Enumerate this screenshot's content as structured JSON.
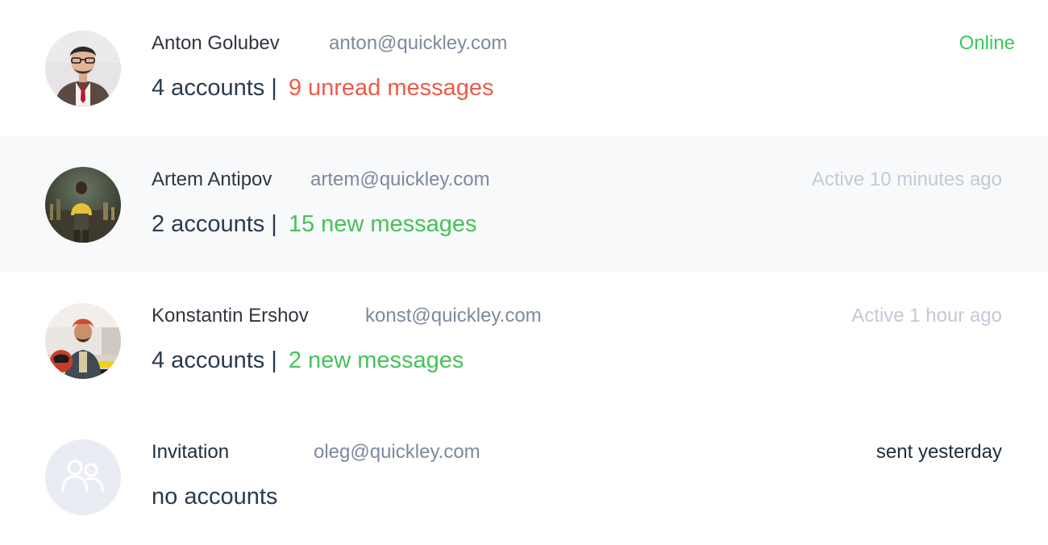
{
  "users": [
    {
      "name": "Anton Golubev",
      "email": "anton@quickley.com",
      "status": "Online",
      "accounts": "4 accounts",
      "separator": "|",
      "messages": "9 unread messages"
    },
    {
      "name": "Artem Antipov",
      "email": "artem@quickley.com",
      "status": "Active 10 minutes ago",
      "accounts": "2 accounts",
      "separator": "|",
      "messages": "15 new messages"
    },
    {
      "name": "Konstantin Ershov",
      "email": "konst@quickley.com",
      "status": "Active 1 hour ago",
      "accounts": "4 accounts",
      "separator": "|",
      "messages": "2 new messages"
    },
    {
      "name": "Invitation",
      "email": "oleg@quickley.com",
      "status": "sent yesterday",
      "accounts": "no accounts"
    }
  ],
  "colors": {
    "online": "#3cc860",
    "unread": "#ec5b4a",
    "new": "#45c25a",
    "muted": "#c3cad6",
    "row_highlight": "#f8f9fb"
  },
  "icons": {
    "invitation_avatar": "users-icon"
  }
}
